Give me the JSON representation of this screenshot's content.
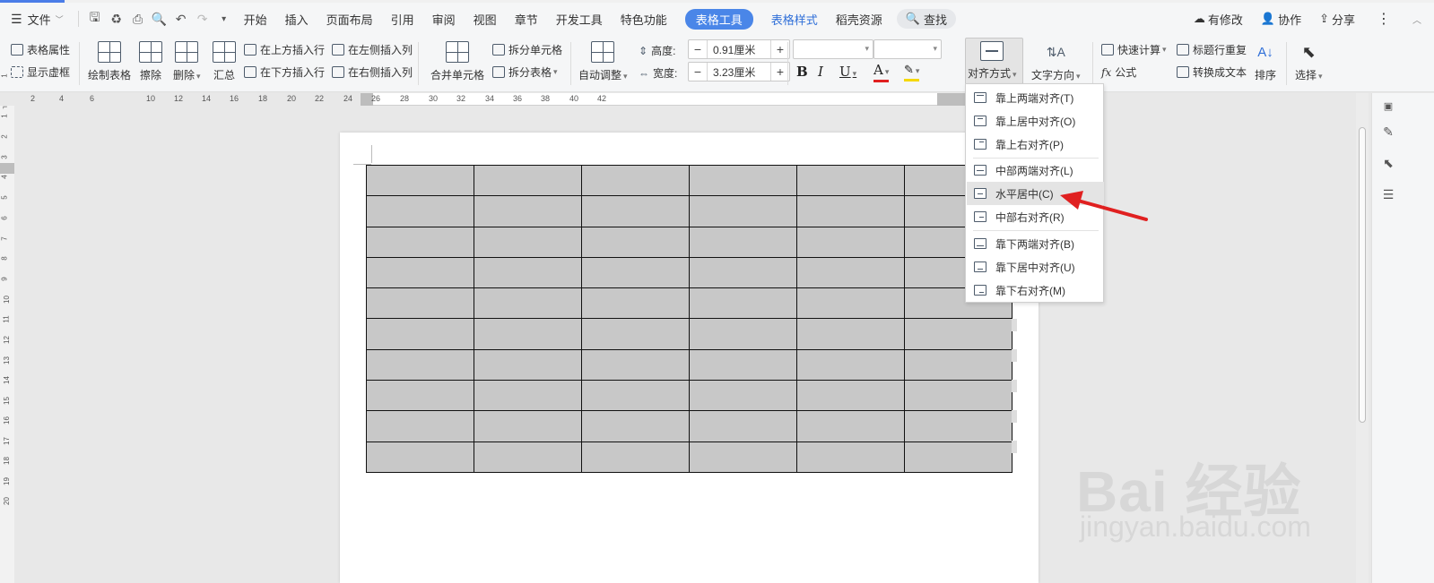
{
  "menubar": {
    "file": "文件",
    "tabs": [
      "开始",
      "插入",
      "页面布局",
      "引用",
      "审阅",
      "视图",
      "章节",
      "开发工具",
      "特色功能"
    ],
    "active_tab": "表格工具",
    "tab_table_style": "表格样式",
    "tab_resources": "稻壳资源",
    "search": "查找",
    "right": {
      "modified": "有修改",
      "collab": "协作",
      "share": "分享"
    }
  },
  "ribbon": {
    "table_props": "表格属性",
    "show_grid": "显示虚框",
    "draw_table": "绘制表格",
    "erase": "擦除",
    "delete": "删除",
    "summary": "汇总",
    "insert_above": "在上方插入行",
    "insert_below": "在下方插入行",
    "insert_left": "在左侧插入列",
    "insert_right": "在右侧插入列",
    "merge_cells": "合并单元格",
    "split_cells": "拆分单元格",
    "split_table": "拆分表格",
    "auto_fit": "自动调整",
    "height_label": "高度:",
    "height_value": "0.91厘米",
    "width_label": "宽度:",
    "width_value": "3.23厘米",
    "align": "对齐方式",
    "text_direction": "文字方向",
    "quick_calc": "快速计算",
    "repeat_header": "标题行重复",
    "formula": "公式",
    "to_text": "转换成文本",
    "sort": "排序",
    "select": "选择"
  },
  "ruler": {
    "h_numbers": [
      "2",
      "4",
      "6",
      "10",
      "12",
      "14",
      "16",
      "18",
      "20",
      "22",
      "24",
      "26",
      "28",
      "30",
      "32",
      "34",
      "36",
      "38",
      "40",
      "42"
    ],
    "v_numbers": [
      "1",
      "1",
      "2",
      "3",
      "4",
      "5",
      "6",
      "7",
      "8",
      "9",
      "10",
      "11",
      "12",
      "13",
      "14",
      "15",
      "16",
      "17",
      "18",
      "19",
      "20"
    ]
  },
  "table": {
    "rows": 10,
    "cols": 6,
    "cell_color": "#c8c8c8"
  },
  "align_menu": {
    "items": [
      "靠上两端对齐(T)",
      "靠上居中对齐(O)",
      "靠上右对齐(P)",
      "中部两端对齐(L)",
      "水平居中(C)",
      "中部右对齐(R)",
      "靠下两端对齐(B)",
      "靠下居中对齐(U)",
      "靠下右对齐(M)"
    ],
    "highlighted_index": 4
  },
  "watermark": {
    "brand": "Bai 经验",
    "url": "jingyan.baidu.com"
  },
  "colors": {
    "accent": "#4a86e8",
    "arrow": "#e02020",
    "menu_highlight": "#e4e4e4"
  }
}
